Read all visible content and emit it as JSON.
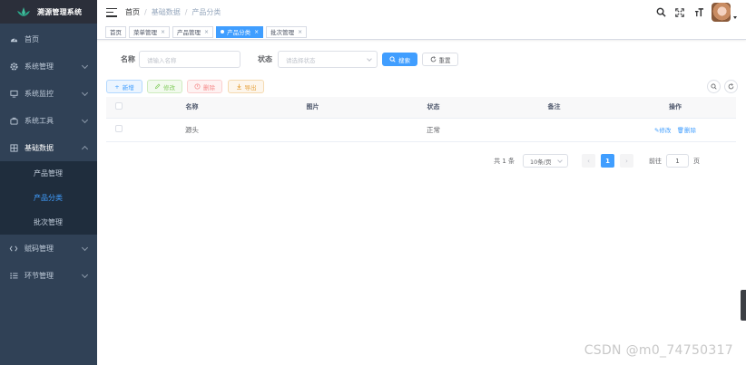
{
  "app": {
    "title": "溯源管理系统"
  },
  "sidebar": {
    "items": [
      {
        "label": "首页",
        "icon": "dashboard-icon"
      },
      {
        "label": "系统管理",
        "icon": "gear-icon"
      },
      {
        "label": "系统监控",
        "icon": "monitor-icon"
      },
      {
        "label": "系统工具",
        "icon": "tool-icon"
      },
      {
        "label": "基础数据",
        "icon": "grid-icon"
      },
      {
        "label": "赋码管理",
        "icon": "code-icon"
      },
      {
        "label": "环节管理",
        "icon": "list-icon"
      }
    ],
    "submenu": [
      "产品管理",
      "产品分类",
      "批次管理"
    ]
  },
  "breadcrumb": {
    "home": "首页",
    "parent": "基础数据",
    "current": "产品分类",
    "sep": "/"
  },
  "tags": [
    {
      "label": "首页"
    },
    {
      "label": "菜单管理"
    },
    {
      "label": "产品管理"
    },
    {
      "label": "产品分类"
    },
    {
      "label": "批次管理"
    }
  ],
  "search": {
    "name_label": "名称",
    "name_placeholder": "请输入名称",
    "status_label": "状态",
    "status_placeholder": "请选择状态",
    "search_btn": "搜索",
    "reset_btn": "重置"
  },
  "actions": {
    "add": "新增",
    "edit": "修改",
    "delete": "删除",
    "export": "导出"
  },
  "table": {
    "headers": [
      "名称",
      "图片",
      "状态",
      "备注",
      "操作"
    ],
    "rows": [
      {
        "name": "源头",
        "image": "",
        "status": "正常",
        "remark": "",
        "op_edit": "修改",
        "op_delete": "删除"
      }
    ]
  },
  "pagination": {
    "total": "共 1 条",
    "page_size": "10条/页",
    "current": "1",
    "goto_label": "前往",
    "goto_value": "1",
    "page_unit": "页"
  },
  "watermark": "CSDN @m0_74750317",
  "colors": {
    "primary": "#409eff",
    "sidebar": "#304156",
    "submenu": "#1f2d3d"
  }
}
